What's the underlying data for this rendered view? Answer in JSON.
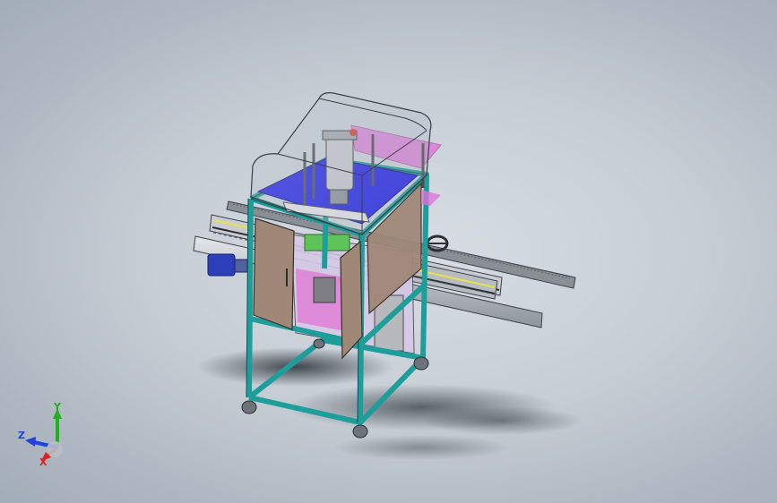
{
  "viewport": {
    "background_top": "#d7dde3",
    "background_bottom": "#a3adb8"
  },
  "model": {
    "frame_color": "#1e9e9a",
    "plate_color": "#2222e8",
    "door_color": "#a08878",
    "film_color": "#e070d8",
    "motor_color": "#2a3fb8"
  },
  "triad": {
    "x_label": "X",
    "y_label": "Y",
    "z_label": "Z",
    "x_color": "#e02020",
    "y_color": "#20b020",
    "z_color": "#2040e0"
  }
}
